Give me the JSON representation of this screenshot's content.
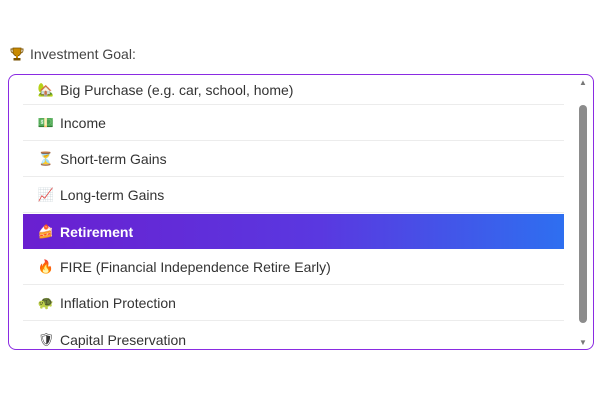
{
  "field": {
    "label": "Investment Goal:",
    "label_icon": "trophy-icon"
  },
  "options": [
    {
      "label": "Big Purchase (e.g. car, school, home)",
      "icon": "house-icon",
      "glyph": "🏡",
      "selected": false
    },
    {
      "label": "Income",
      "icon": "money-icon",
      "glyph": "💵",
      "selected": false
    },
    {
      "label": "Short-term Gains",
      "icon": "hourglass-icon",
      "glyph": "⏳",
      "selected": false
    },
    {
      "label": "Long-term Gains",
      "icon": "chart-up-icon",
      "glyph": "📈",
      "selected": false
    },
    {
      "label": "Retirement",
      "icon": "cake-icon",
      "glyph": "🍰",
      "selected": true
    },
    {
      "label": "FIRE (Financial Independence Retire Early)",
      "icon": "fire-icon",
      "glyph": "🔥",
      "selected": false
    },
    {
      "label": "Inflation Protection",
      "icon": "turtle-icon",
      "glyph": "🐢",
      "selected": false
    },
    {
      "label": "Capital Preservation",
      "icon": "shield-icon",
      "glyph": "🛡",
      "selected": false
    }
  ],
  "colors": {
    "border": "#8a2be2",
    "selected_start": "#6a1fd0",
    "selected_end": "#2e6ff0"
  }
}
